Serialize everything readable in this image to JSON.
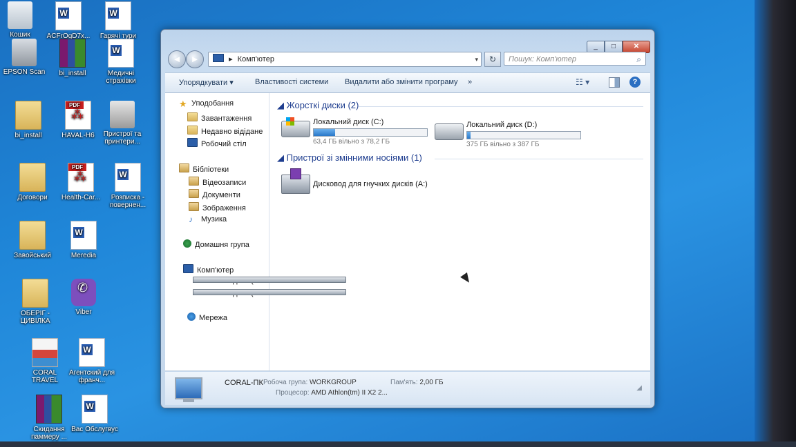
{
  "desktop": {
    "icons": [
      {
        "label": "Кошик",
        "type": "recycle"
      },
      {
        "label": "ACFrOgD7x...",
        "type": "word"
      },
      {
        "label": "Гарячі тури",
        "type": "word"
      },
      {
        "label": "EPSON Scan",
        "type": "scan"
      },
      {
        "label": "bi_install",
        "type": "rar"
      },
      {
        "label": "Медичні страхівки",
        "type": "word"
      },
      {
        "label": "bi_install",
        "type": "folder"
      },
      {
        "label": "HAVAL-H6",
        "type": "pdf"
      },
      {
        "label": "Пристрої та принтери...",
        "type": "printer"
      },
      {
        "label": "Договори",
        "type": "folder"
      },
      {
        "label": "Health-Car...",
        "type": "pdf"
      },
      {
        "label": "Розписка - повернен...",
        "type": "word"
      },
      {
        "label": "Завойський",
        "type": "folder"
      },
      {
        "label": "Meredia",
        "type": "word"
      },
      {
        "label": "ОБЕРІГ - ЦИВІЛКА",
        "type": "folder"
      },
      {
        "label": "Viber",
        "type": "viber"
      },
      {
        "label": "CORAL TRAVEL",
        "type": "coral"
      },
      {
        "label": "Агентский для франч...",
        "type": "word"
      },
      {
        "label": "Скидання паммеру ...",
        "type": "rar"
      },
      {
        "label": "Вас Обслугвус",
        "type": "word"
      }
    ]
  },
  "window": {
    "caption_buttons": {
      "minimize": "_",
      "maximize": "□",
      "close": "✕"
    },
    "nav": {
      "back": "◄",
      "forward": "►"
    },
    "address": {
      "separator": "▸",
      "path": "Комп'ютер",
      "dropdown": "▾"
    },
    "refresh": "↻",
    "search": {
      "placeholder": "Пошук: Комп'ютер",
      "icon": "⌕"
    },
    "toolbar": {
      "organize": "Упорядкувати ▾",
      "system_properties": "Властивості системи",
      "uninstall": "Видалити або змінити програму",
      "more": "»",
      "views": "☷ ▾",
      "help": "?"
    },
    "nav_pane": {
      "favorites": "Уподобання",
      "downloads": "Завантаження",
      "recent": "Недавно відідане",
      "desktop": "Робочий стіл",
      "libraries": "Бібліотеки",
      "videos": "Відеозаписи",
      "documents": "Документи",
      "pictures": "Зображення",
      "music": "Музика",
      "homegroup": "Домашня група",
      "computer": "Комп'ютер",
      "drive_c": "Локальний диск (C:",
      "drive_d": "Локальний диск (D:",
      "network": "Мережа"
    },
    "groups": {
      "hard_disks": "Жорсткі диски (2)",
      "removable": "Пристрої зі змінними носіями (1)"
    },
    "drives": {
      "c": {
        "name": "Локальний диск (C:)",
        "free": "63,4 ГБ вільно з 78,2 ГБ",
        "used_fraction": 0.19
      },
      "d": {
        "name": "Локальний диск (D:)",
        "free": "375 ГБ вільно з 387 ГБ",
        "used_fraction": 0.03
      },
      "a": {
        "name": "Дисковод для гнучких дисків (A:)"
      }
    },
    "details": {
      "pc_name": "CORAL-ПК",
      "workgroup_label": "Робоча група:",
      "workgroup": "WORKGROUP",
      "memory_label": "Пам'ять:",
      "memory": "2,00 ГБ",
      "cpu_label": "Процесор:",
      "cpu": "AMD Athlon(tm) II X2 2..."
    },
    "collapse_arrow": "◢"
  }
}
